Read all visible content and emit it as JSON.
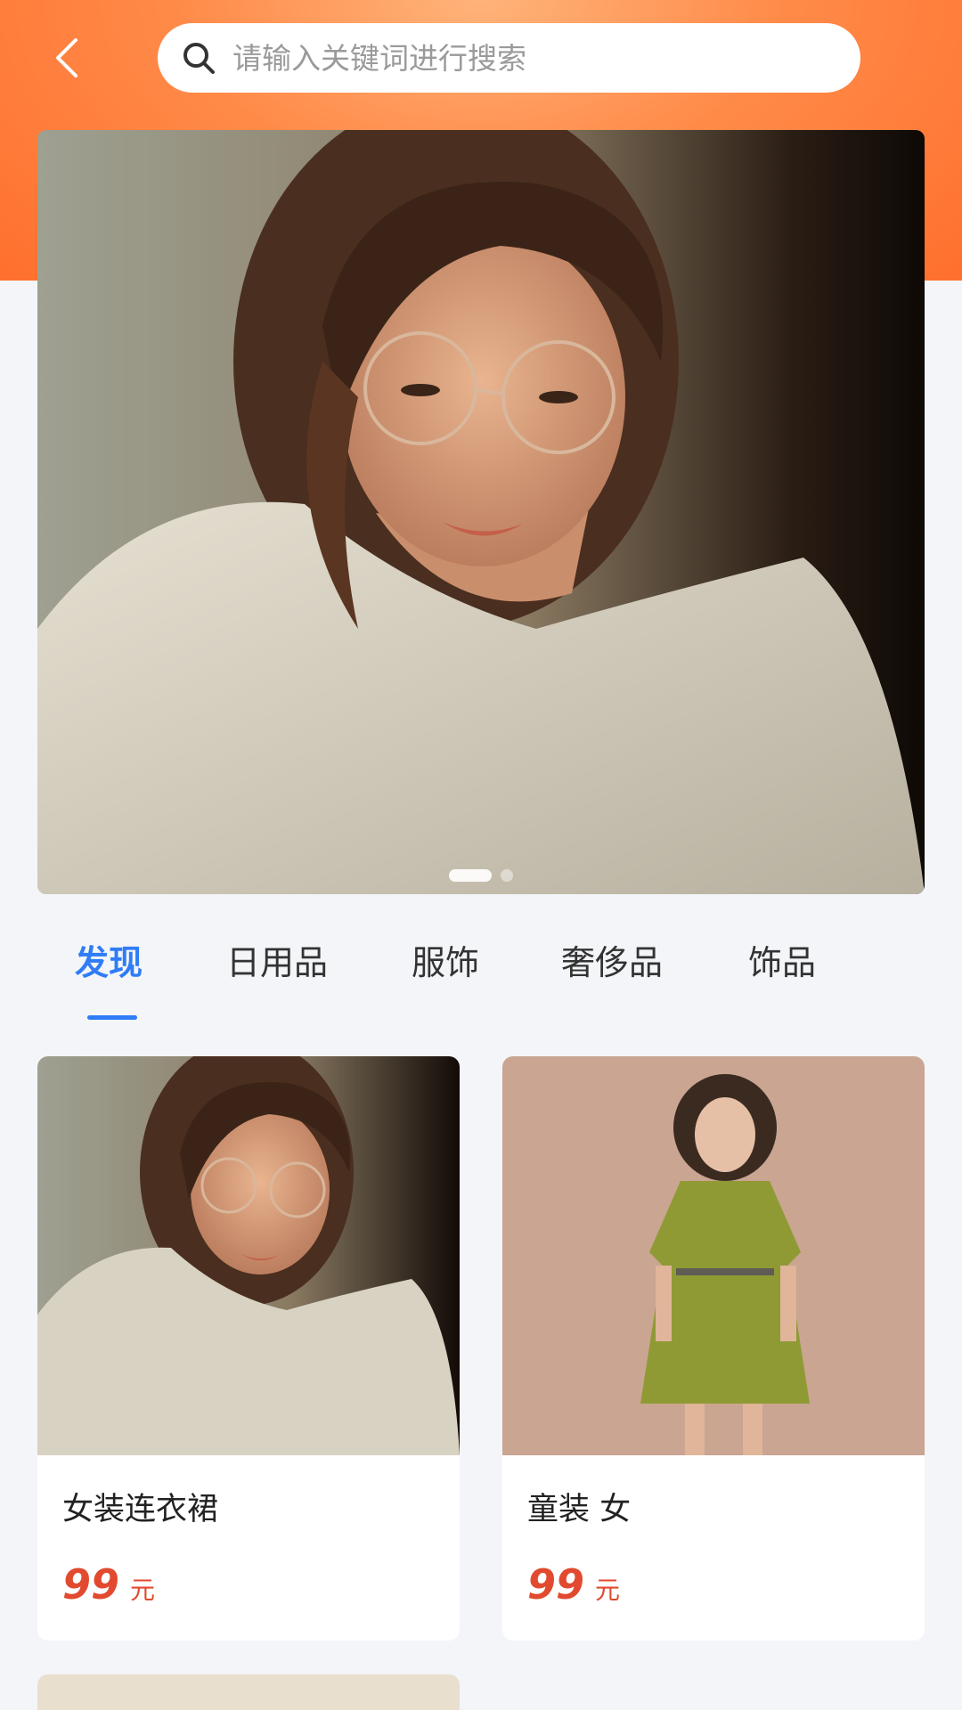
{
  "header": {
    "search_placeholder": "请输入关键词进行搜索",
    "accent_color": "#ff7a3c"
  },
  "banner": {
    "dots": {
      "count": 2,
      "active": 0
    }
  },
  "tabs": [
    {
      "label": "发现",
      "active": true
    },
    {
      "label": "日用品",
      "active": false
    },
    {
      "label": "服饰",
      "active": false
    },
    {
      "label": "奢侈品",
      "active": false
    },
    {
      "label": "饰品",
      "active": false
    }
  ],
  "products": [
    {
      "title": "女装连衣裙",
      "price": "99",
      "unit": "元"
    },
    {
      "title": "童装 女",
      "price": "99",
      "unit": "元"
    }
  ],
  "colors": {
    "tab_active": "#2f7cf6",
    "price": "#e14a2f",
    "page_background": "#f3f5f9"
  }
}
